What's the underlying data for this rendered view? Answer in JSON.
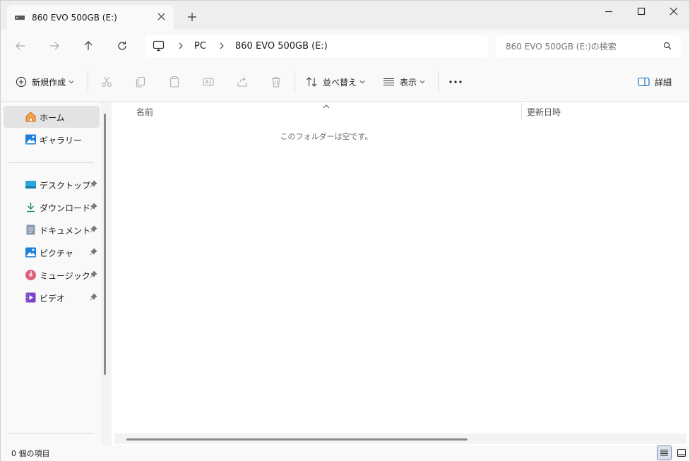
{
  "tab": {
    "title": "860 EVO 500GB (E:)"
  },
  "breadcrumb": {
    "pc": "PC",
    "drive": "860 EVO 500GB (E:)"
  },
  "search": {
    "placeholder": "860 EVO 500GB (E:)の検索"
  },
  "toolbar": {
    "new_label": "新規作成",
    "sort_label": "並べ替え",
    "view_label": "表示",
    "details_label": "詳細"
  },
  "sidebar": {
    "items": [
      {
        "label": "ホーム",
        "icon": "home-icon"
      },
      {
        "label": "ギャラリー",
        "icon": "gallery-icon"
      },
      {
        "label": "デスクトップ",
        "icon": "desktop-folder-icon"
      },
      {
        "label": "ダウンロード",
        "icon": "download-icon"
      },
      {
        "label": "ドキュメント",
        "icon": "document-icon"
      },
      {
        "label": "ピクチャ",
        "icon": "pictures-icon"
      },
      {
        "label": "ミュージック",
        "icon": "music-icon"
      },
      {
        "label": "ビデオ",
        "icon": "video-icon"
      }
    ]
  },
  "columns": {
    "name": "名前",
    "date": "更新日時"
  },
  "content": {
    "empty_message": "このフォルダーは空です。"
  },
  "status": {
    "item_count": "0 個の項目"
  },
  "colors": {
    "accent": "#0067c0",
    "selected_bg": "#e3e3e3",
    "home_icon": "#e8892b"
  }
}
